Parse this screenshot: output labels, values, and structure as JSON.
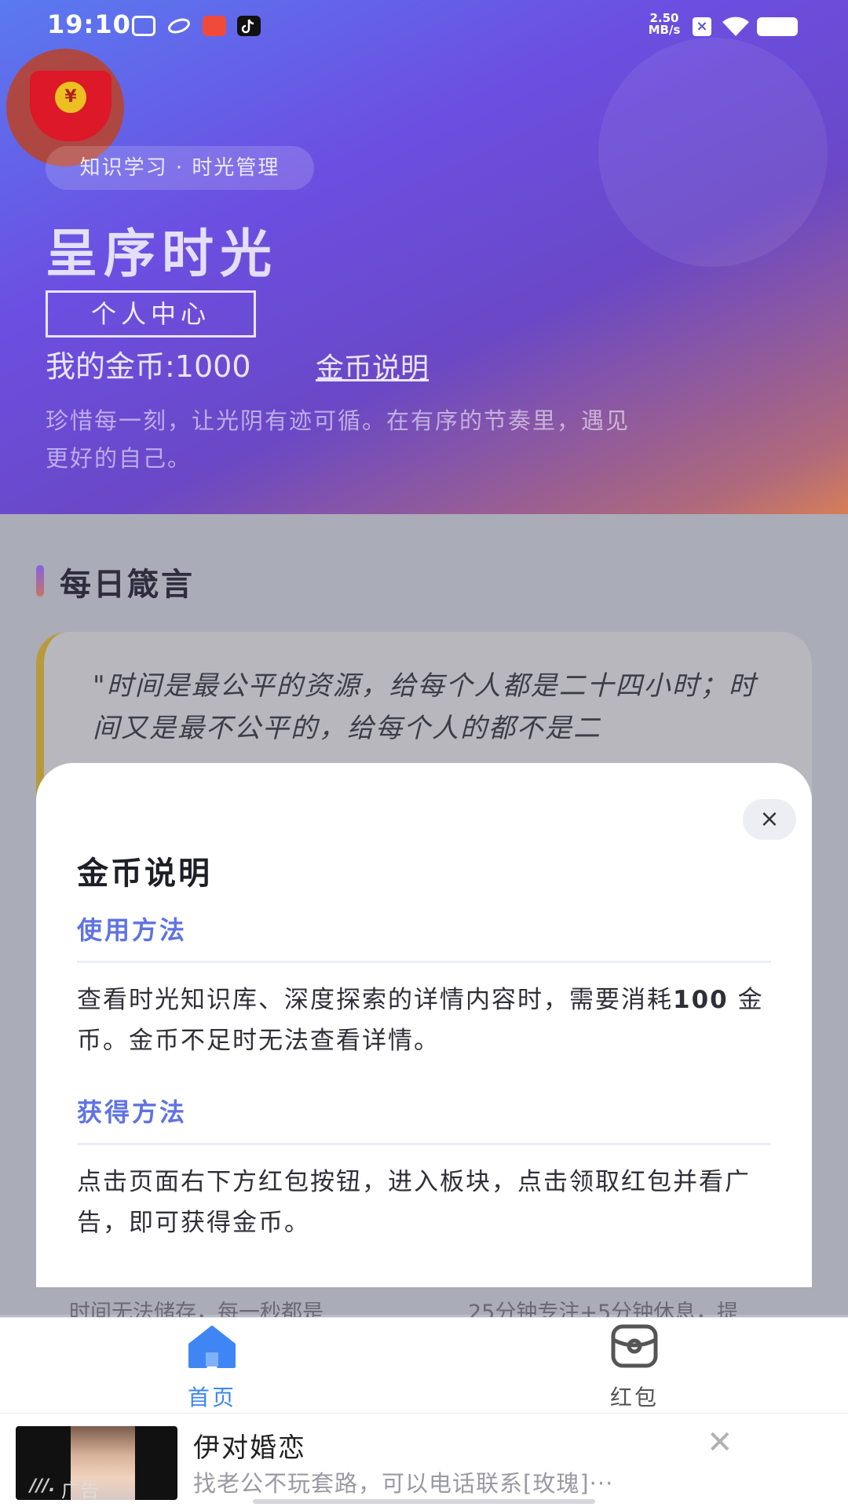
{
  "status_bar": {
    "time": "19:10",
    "network_speed_value": "2.50",
    "network_speed_unit": "MB/s"
  },
  "header": {
    "chip": "知识学习 · 时光管理",
    "title": "呈序时光",
    "personal_center_button": "个人中心",
    "coins_label": "我的金币:1000",
    "coins_link": "金币说明",
    "slogan": "珍惜每一刻，让光阴有迹可循。在有序的节奏里，遇见更好的自己。"
  },
  "daily_quote": {
    "section_title": "每日箴言",
    "quote": "\"时间是最公平的资源，给每个人都是二十四小时；时间又是最不公平的，给每个人的都不是二"
  },
  "background_cards": {
    "left_text": "时间无法储存，每一秒都是",
    "right_text": "25分钟专注+5分钟休息，提"
  },
  "modal": {
    "close_symbol": "×",
    "title": "金币说明",
    "usage_heading": "使用方法",
    "usage_text_1": "查看时光知识库、深度探索的详情内容时，需要消耗",
    "usage_amount": "100",
    "usage_text_2": " 金币。金币不足时无法查看详情。",
    "earn_heading": "获得方法",
    "earn_text": "点击页面右下方红包按钮，进入板块，点击领取红包并看广告，即可获得金币。"
  },
  "bottom_nav": {
    "items": [
      {
        "label": "首页",
        "icon": "home-icon",
        "active": true
      },
      {
        "label": "红包",
        "icon": "red-packet-icon",
        "active": false
      }
    ],
    "active_color": "#3f86f4",
    "inactive_color": "#555555"
  },
  "ad": {
    "tag": "广告",
    "title": "伊对婚恋",
    "description": "找老公不玩套路，可以电话联系[玫瑰]···",
    "close_symbol": "✕"
  },
  "colors": {
    "accent": "#5f73e2",
    "redpack": "#e3141f",
    "coin": "#f5c518"
  }
}
